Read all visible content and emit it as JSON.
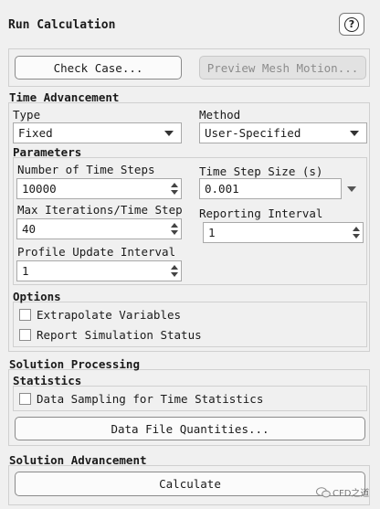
{
  "title": "Run Calculation",
  "help_label": "?",
  "buttons": {
    "check_case": "Check Case...",
    "preview_mesh_motion": "Preview Mesh Motion...",
    "data_file_quantities": "Data File Quantities...",
    "calculate": "Calculate"
  },
  "time_advancement": {
    "heading": "Time Advancement",
    "type_label": "Type",
    "type_value": "Fixed",
    "method_label": "Method",
    "method_value": "User-Specified"
  },
  "parameters": {
    "heading": "Parameters",
    "num_time_steps_label": "Number of Time Steps",
    "num_time_steps_value": "10000",
    "time_step_size_label": "Time Step Size (s)",
    "time_step_size_value": "0.001",
    "max_iter_label": "Max Iterations/Time Step",
    "max_iter_value": "40",
    "reporting_interval_label": "Reporting Interval",
    "reporting_interval_value": "1",
    "profile_update_label": "Profile Update Interval",
    "profile_update_value": "1"
  },
  "options": {
    "heading": "Options",
    "extrapolate_label": "Extrapolate Variables",
    "extrapolate_checked": false,
    "report_status_label": "Report Simulation Status",
    "report_status_checked": false
  },
  "solution_processing": {
    "heading": "Solution Processing",
    "statistics_heading": "Statistics",
    "data_sampling_label": "Data Sampling for Time Statistics",
    "data_sampling_checked": false
  },
  "solution_advancement": {
    "heading": "Solution Advancement"
  },
  "watermark": "CFD之道"
}
